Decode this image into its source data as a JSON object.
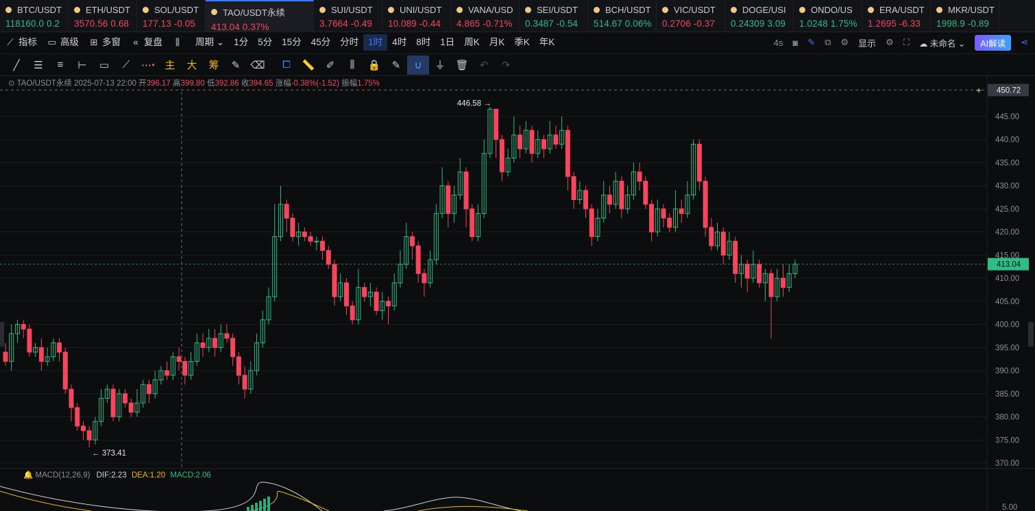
{
  "tickers": [
    {
      "sym": "BTC/USDT",
      "price": "118160.0",
      "chg": "0.2",
      "dir": "up"
    },
    {
      "sym": "ETH/USDT",
      "price": "3570.56",
      "chg": "0.68",
      "dir": "dn"
    },
    {
      "sym": "SOL/USDT",
      "price": "177.13",
      "chg": "-0.05",
      "dir": "dn"
    },
    {
      "sym": "TAO/USDT永续",
      "price": "413.04",
      "chg": "0.37%",
      "dir": "dn",
      "active": true
    },
    {
      "sym": "SUI/USDT",
      "price": "3.7664",
      "chg": "-0.49",
      "dir": "dn"
    },
    {
      "sym": "UNI/USDT",
      "price": "10.089",
      "chg": "-0.44",
      "dir": "dn"
    },
    {
      "sym": "VANA/USD",
      "price": "4.865",
      "chg": "-0.71%",
      "dir": "dn"
    },
    {
      "sym": "SEI/USDT",
      "price": "0.3487",
      "chg": "-0.54",
      "dir": "up"
    },
    {
      "sym": "BCH/USDT",
      "price": "514.67",
      "chg": "0.06%",
      "dir": "up"
    },
    {
      "sym": "VIC/USDT",
      "price": "0.2706",
      "chg": "-0.37",
      "dir": "dn"
    },
    {
      "sym": "DOGE/USI",
      "price": "0.24309",
      "chg": "3.09",
      "dir": "up"
    },
    {
      "sym": "ONDO/US",
      "price": "1.0248",
      "chg": "1.75%",
      "dir": "up"
    },
    {
      "sym": "ERA/USDT",
      "price": "1.2695",
      "chg": "-6.33",
      "dir": "dn"
    },
    {
      "sym": "MKR/USDT",
      "price": "1998.9",
      "chg": "-0.89",
      "dir": "up"
    }
  ],
  "toolbar": {
    "indicator": "指标",
    "advanced": "高级",
    "multi": "多窗",
    "replay": "复盘",
    "period": "周期",
    "intervals": [
      "1分",
      "5分",
      "15分",
      "45分",
      "分时",
      "1时",
      "4时",
      "8时",
      "1日",
      "周K",
      "月K",
      "季K",
      "年K"
    ],
    "selected_interval": "1时",
    "right": {
      "refresh": "4s",
      "display": "显示",
      "layout": "未命名",
      "ai": "AI解读"
    }
  },
  "drawtools": {
    "main": "主",
    "big": "大",
    "chip": "筹"
  },
  "info": {
    "symbol": "TAO/USDT永续",
    "datetime": "2025-07-13 22:00",
    "open_lbl": "开",
    "open": "396.17",
    "high_lbl": "高",
    "high": "399.80",
    "low_lbl": "低",
    "low": "392.86",
    "close_lbl": "收",
    "close": "394.65",
    "chg_lbl": "涨幅",
    "chg": "-0.38%(-1.52)",
    "amp_lbl": "振幅",
    "amp": "1.75%"
  },
  "macd": {
    "label": "MACD(12,26,9)",
    "dif": "DIF:2.23",
    "dea": "DEA:1.20",
    "macd": "MACD:2.06",
    "axis_top": "5.00"
  },
  "chart_data": {
    "type": "candlestick",
    "symbol": "TAO/USDT",
    "y_ticks": [
      445,
      440,
      435,
      430,
      425,
      420,
      415,
      410,
      405,
      400,
      395,
      390,
      385,
      380,
      375,
      370
    ],
    "y_tick_labels": [
      "445.00",
      "440.00",
      "435.00",
      "430.00",
      "425.00",
      "420.00",
      "415.00",
      "410.00",
      "405.00",
      "400.00",
      "395.00",
      "390.00",
      "385.00",
      "380.00",
      "375.00",
      "370.00"
    ],
    "ylim": [
      366,
      452
    ],
    "max_label": "446.58",
    "min_label": "373.41",
    "last_price": "413.04",
    "crosshair_price": "450.72",
    "last_value": 413.04,
    "crosshair_value": 450.72,
    "candles": [
      [
        394,
        392,
        396,
        391
      ],
      [
        392,
        398,
        400,
        390
      ],
      [
        398,
        400,
        401,
        396
      ],
      [
        400,
        399,
        401,
        397
      ],
      [
        399,
        394,
        400,
        393
      ],
      [
        394,
        395,
        396,
        393
      ],
      [
        395,
        392,
        397,
        390
      ],
      [
        392,
        393,
        395,
        391
      ],
      [
        393,
        396,
        397,
        392
      ],
      [
        396,
        394,
        397,
        392
      ],
      [
        394,
        386,
        395,
        385
      ],
      [
        386,
        382,
        387,
        379
      ],
      [
        382,
        378,
        383,
        377
      ],
      [
        378,
        377,
        379,
        375
      ],
      [
        377,
        375,
        378,
        373.41
      ],
      [
        375,
        379,
        380,
        374
      ],
      [
        379,
        384,
        386,
        378
      ],
      [
        384,
        386,
        387,
        383
      ],
      [
        386,
        380,
        387,
        379
      ],
      [
        380,
        385,
        386,
        379
      ],
      [
        385,
        383,
        386,
        382
      ],
      [
        383,
        381,
        384,
        380
      ],
      [
        381,
        383,
        386,
        380
      ],
      [
        383,
        387,
        388,
        382
      ],
      [
        387,
        385,
        388,
        383
      ],
      [
        385,
        388,
        390,
        384
      ],
      [
        388,
        390,
        391,
        387
      ],
      [
        390,
        389,
        392,
        388
      ],
      [
        389,
        393,
        394,
        388
      ],
      [
        393,
        392,
        395,
        390
      ],
      [
        392,
        389,
        393,
        387
      ],
      [
        389,
        392,
        394,
        388
      ],
      [
        392,
        396,
        398,
        391
      ],
      [
        396,
        395,
        398,
        393
      ],
      [
        395,
        397,
        399,
        394
      ],
      [
        397,
        395,
        399,
        393
      ],
      [
        395,
        398,
        400,
        394
      ],
      [
        398,
        397,
        400,
        396
      ],
      [
        397,
        393,
        398,
        391
      ],
      [
        393,
        389,
        394,
        387
      ],
      [
        389,
        386,
        391,
        384
      ],
      [
        386,
        390,
        392,
        385
      ],
      [
        390,
        396,
        398,
        389
      ],
      [
        396,
        401,
        403,
        395
      ],
      [
        401,
        406,
        408,
        400
      ],
      [
        406,
        419,
        426,
        405
      ],
      [
        419,
        426,
        430,
        418
      ],
      [
        426,
        423,
        427,
        420
      ],
      [
        423,
        419,
        424,
        418
      ],
      [
        419,
        420,
        422,
        417
      ],
      [
        420,
        419,
        421,
        418
      ],
      [
        419,
        418,
        420,
        417
      ],
      [
        418,
        418,
        419,
        416
      ],
      [
        418,
        416,
        419,
        414
      ],
      [
        416,
        413,
        417,
        412
      ],
      [
        413,
        406,
        414,
        404
      ],
      [
        406,
        409,
        411,
        405
      ],
      [
        409,
        404,
        410,
        402
      ],
      [
        404,
        401,
        405,
        400
      ],
      [
        401,
        408,
        412,
        400
      ],
      [
        408,
        406,
        409,
        405
      ],
      [
        406,
        407,
        409,
        404
      ],
      [
        407,
        403,
        408,
        402
      ],
      [
        403,
        405,
        407,
        401
      ],
      [
        405,
        404,
        406,
        400
      ],
      [
        404,
        409,
        411,
        403
      ],
      [
        409,
        413,
        416,
        408
      ],
      [
        413,
        419,
        422,
        412
      ],
      [
        419,
        417,
        420,
        414
      ],
      [
        417,
        411,
        418,
        409
      ],
      [
        411,
        409,
        412,
        406
      ],
      [
        409,
        414,
        416,
        408
      ],
      [
        414,
        424,
        426,
        413
      ],
      [
        424,
        430,
        434,
        423
      ],
      [
        430,
        424,
        431,
        421
      ],
      [
        424,
        428,
        430,
        422
      ],
      [
        428,
        433,
        436,
        427
      ],
      [
        433,
        425,
        434,
        421
      ],
      [
        425,
        419,
        426,
        418
      ],
      [
        419,
        424,
        426,
        418
      ],
      [
        424,
        437,
        440,
        423
      ],
      [
        437,
        446.58,
        447,
        436
      ],
      [
        446.58,
        440,
        445,
        436
      ],
      [
        440,
        433,
        441,
        431
      ],
      [
        433,
        436,
        438,
        432
      ],
      [
        436,
        441,
        445,
        435
      ],
      [
        441,
        438,
        443,
        436
      ],
      [
        438,
        442,
        444,
        437
      ],
      [
        442,
        437,
        443,
        435
      ],
      [
        437,
        440,
        442,
        436
      ],
      [
        440,
        438,
        441,
        436
      ],
      [
        438,
        441,
        444,
        437
      ],
      [
        441,
        439,
        443,
        438
      ],
      [
        439,
        442,
        445,
        438
      ],
      [
        442,
        432,
        443,
        429
      ],
      [
        432,
        427,
        433,
        425
      ],
      [
        427,
        429,
        431,
        426
      ],
      [
        429,
        425,
        430,
        423
      ],
      [
        425,
        419,
        426,
        417
      ],
      [
        419,
        423,
        425,
        418
      ],
      [
        423,
        428,
        431,
        422
      ],
      [
        428,
        426,
        430,
        424
      ],
      [
        426,
        431,
        433,
        425
      ],
      [
        431,
        425,
        432,
        423
      ],
      [
        425,
        428,
        430,
        424
      ],
      [
        428,
        433,
        435,
        427
      ],
      [
        433,
        431,
        435,
        429
      ],
      [
        431,
        426,
        432,
        425
      ],
      [
        426,
        420,
        427,
        418
      ],
      [
        420,
        425,
        427,
        419
      ],
      [
        425,
        423,
        426,
        421
      ],
      [
        423,
        421,
        424,
        420
      ],
      [
        421,
        425,
        429,
        420
      ],
      [
        425,
        424,
        427,
        422
      ],
      [
        424,
        428,
        431,
        423
      ],
      [
        428,
        439,
        440,
        427
      ],
      [
        439,
        431,
        440,
        429
      ],
      [
        431,
        421,
        432,
        419
      ],
      [
        421,
        417,
        423,
        416
      ],
      [
        417,
        420,
        422,
        416
      ],
      [
        420,
        415,
        421,
        413
      ],
      [
        415,
        418,
        420,
        414
      ],
      [
        418,
        411,
        419,
        409
      ],
      [
        411,
        413,
        415,
        408
      ],
      [
        413,
        410,
        414,
        407
      ],
      [
        410,
        413,
        416,
        409
      ],
      [
        413,
        409,
        414,
        408
      ],
      [
        409,
        411,
        412,
        405
      ],
      [
        411,
        406,
        412,
        397
      ],
      [
        406,
        410,
        412,
        405
      ],
      [
        410,
        408,
        413,
        406
      ],
      [
        408,
        411,
        413,
        407
      ],
      [
        411,
        413.04,
        414,
        410
      ]
    ]
  }
}
